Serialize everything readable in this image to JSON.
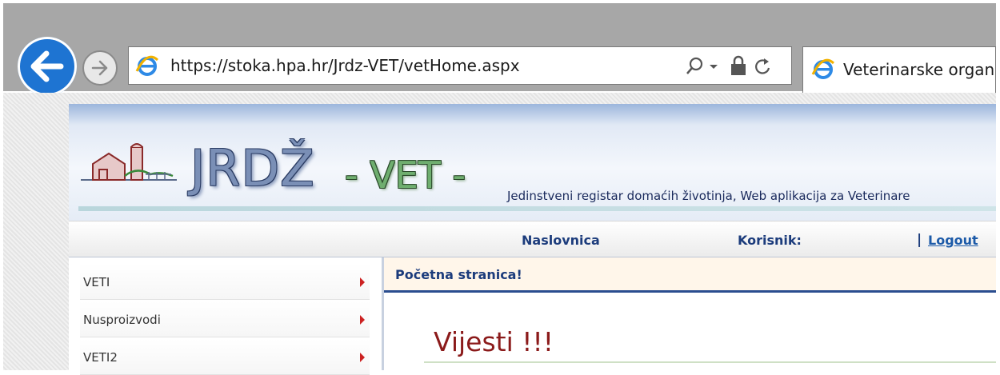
{
  "browser": {
    "url": "https://stoka.hpa.hr/Jrdz-VET/vetHome.aspx",
    "tab_title": "Veterinarske organ",
    "icons": [
      "back-arrow-icon",
      "forward-arrow-icon",
      "ie-logo-icon",
      "search-icon",
      "dropdown-icon",
      "lock-icon",
      "refresh-icon"
    ]
  },
  "banner": {
    "logo_text": "JRDŽ",
    "vet_text": "- VET -",
    "subtitle": "Jedinstveni registar domaćih životinja, Web aplikacija za Veterinare"
  },
  "nav": {
    "home": "Naslovnica",
    "user_label": "Korisnik:",
    "separator": "|",
    "logout": "Logout"
  },
  "sidebar": {
    "items": [
      {
        "label": "VETI"
      },
      {
        "label": "Nusproizvodi"
      },
      {
        "label": "VETI2"
      }
    ]
  },
  "content": {
    "header": "Početna stranica!",
    "news_title": "Vijesti !!!"
  },
  "colors": {
    "back_button": "#1e74d2",
    "nav_text": "#1c3c7c",
    "news_title": "#8b1a1a",
    "menu_arrow": "#cc2222"
  }
}
